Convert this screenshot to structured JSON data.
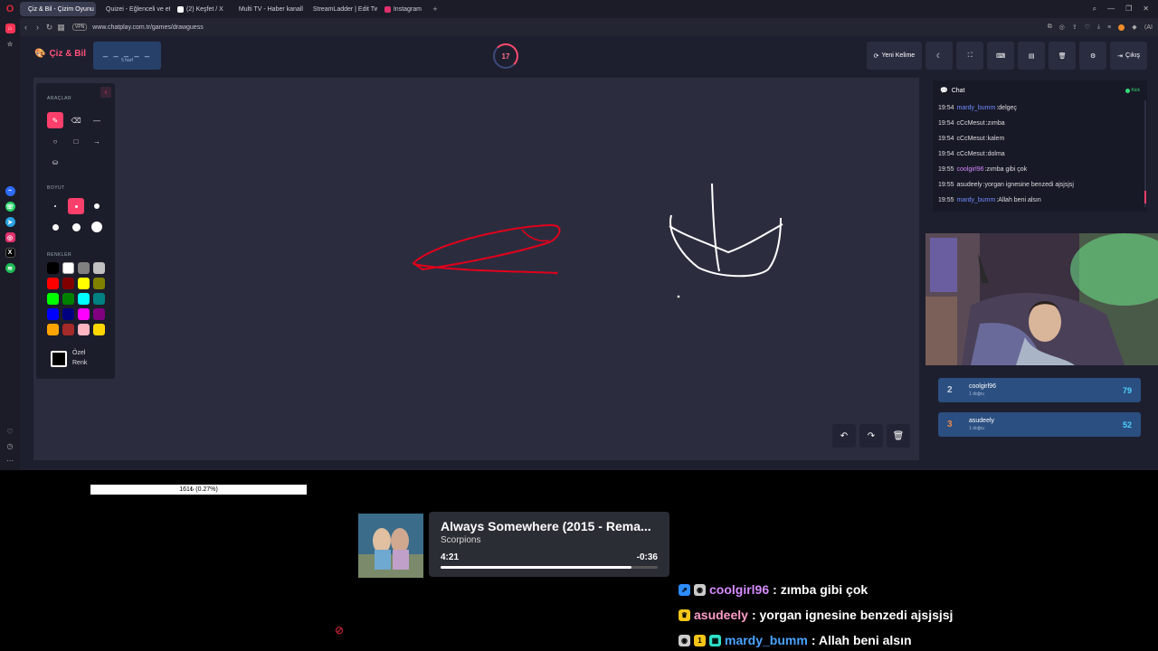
{
  "browser": {
    "tabs": [
      {
        "label": "Çiz & Bil - Çizim Oyunu",
        "color": "#ff4f79",
        "active": true
      },
      {
        "label": "Quizei - Eğlenceli ve etkile...",
        "color": "#2ecc71",
        "active": false
      },
      {
        "label": "(2) Keşfet / X",
        "color": "#ffffff",
        "active": false
      },
      {
        "label": "Multi TV - Haber kanalları...",
        "color": "#cccccc",
        "active": false
      },
      {
        "label": "StreamLadder | Edit Twitch...",
        "color": "#6a5cff",
        "active": false
      },
      {
        "label": "Instagram",
        "color": "#e1306c",
        "active": false
      }
    ],
    "url": "www.chatplay.com.tr/games/drawguess",
    "vpn": "VPN",
    "ai_label": "AI"
  },
  "game": {
    "brand": "Çiz & Bil",
    "word_blanks": "_ _ _ _ _",
    "word_hint": "5 harf",
    "timer": "17",
    "buttons": {
      "new_word": "Yeni Kelime",
      "exit": "Çıkış"
    },
    "tools_panel": {
      "tools_label": "ARAÇLAR",
      "size_label": "BOYUT",
      "colors_label": "RENKLER",
      "custom_color": [
        "Özel",
        "Renk"
      ],
      "swatches": [
        "#000000",
        "#ffffff",
        "#808080",
        "#c0c0c0",
        "#ff0000",
        "#800000",
        "#ffff00",
        "#808000",
        "#00ff00",
        "#008000",
        "#00ffff",
        "#008080",
        "#0000ff",
        "#000080",
        "#ff00ff",
        "#800080",
        "#ffa500",
        "#a52a2a",
        "#ffb6c1",
        "#ffd700"
      ]
    },
    "colors": {
      "accent": "#ff3f6b",
      "stroke_red": "#e0001b",
      "stroke_white": "#ffffff"
    }
  },
  "chat": {
    "title": "Chat",
    "kick": "Kick",
    "messages": [
      {
        "time": "19:54",
        "user": "mardy_bumm",
        "color": "#6f8dff",
        "text": "delgeç"
      },
      {
        "time": "19:54",
        "user": "cCcMesut",
        "color": "#dddddd",
        "text": "zımba"
      },
      {
        "time": "19:54",
        "user": "cCcMesut",
        "color": "#dddddd",
        "text": "kalem"
      },
      {
        "time": "19:54",
        "user": "cCcMesut",
        "color": "#dddddd",
        "text": "dolma"
      },
      {
        "time": "19:55",
        "user": "coolgirl96",
        "color": "#d58bff",
        "text": "zımba gibi çok"
      },
      {
        "time": "19:55",
        "user": "asudeely",
        "color": "#dddddd",
        "text": "yorgan ignesine benzedi ajsjsjsj"
      },
      {
        "time": "19:55",
        "user": "mardy_bumm",
        "color": "#6f8dff",
        "text": "Allah beni alsın"
      }
    ]
  },
  "leaderboard": [
    {
      "rank": "2",
      "name": "coolgirl96",
      "sub": "1 doğru",
      "score": "79",
      "rank_color": "#c7d0dd"
    },
    {
      "rank": "3",
      "name": "asudeely",
      "sub": "1 doğru",
      "score": "52",
      "rank_color": "#e8894a"
    }
  ],
  "overlay": {
    "progress_text": "161₺ (0.27%)",
    "now_playing": {
      "title": "Always Somewhere (2015 - Rema...",
      "artist": "Scorpions",
      "elapsed": "4:21",
      "remaining": "-0:36",
      "progress_fraction": 0.88
    },
    "chat": [
      {
        "user": "coolgirl96",
        "color": "#d58bff",
        "text": ": zımba gibi çok"
      },
      {
        "user": "asudeely",
        "color": "#ff9ec8",
        "text": ": yorgan ignesine benzedi ajsjsjsj"
      },
      {
        "user": "mardy_bumm",
        "color": "#4aa3ff",
        "text": ": Allah beni alsın"
      }
    ]
  }
}
